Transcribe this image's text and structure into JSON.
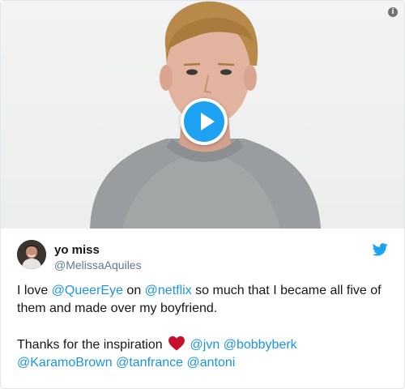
{
  "colors": {
    "accent": "#1da1f2",
    "link": "#1b95e0",
    "text": "#14171a",
    "muted": "#657786",
    "heart": "#c8102e"
  },
  "media": {
    "info_icon": "info-icon",
    "play_icon": "play-icon"
  },
  "tweet": {
    "author": {
      "name": "yo miss",
      "handle": "@MelissaAquiles"
    },
    "body": {
      "p1": {
        "t1": "I love ",
        "m1": "@QueerEye",
        "t2": " on ",
        "m2": "@netflix",
        "t3": " so much that I became all five of them and made over my boyfriend."
      },
      "p2": {
        "t1": "Thanks for the inspiration ",
        "m1": "@jvn",
        "m2": "@bobbyberk",
        "m3": "@KaramoBrown",
        "m4": "@tanfrance",
        "m5": "@antoni"
      }
    }
  }
}
